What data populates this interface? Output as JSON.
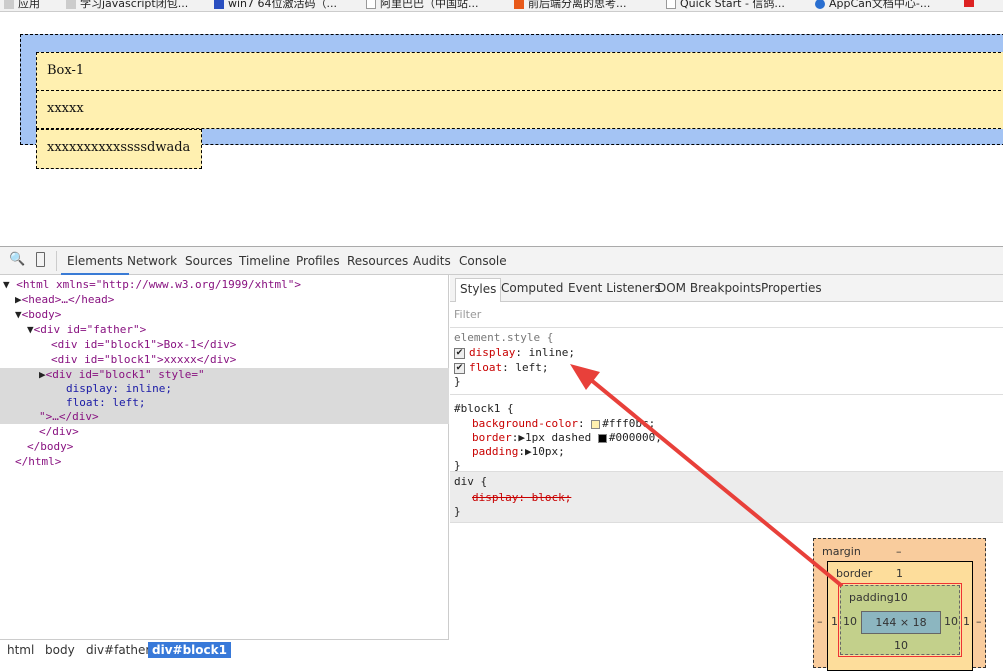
{
  "bookmarks": [
    "应用",
    "学习javascript闭包...",
    "win7 64位激活码（...",
    "阿里巴巴（中国站...",
    "前后端分离的思考...",
    "Quick Start - 信鸽...",
    "AppCan文档中心-..."
  ],
  "page": {
    "box1": "Box-1",
    "box2": "xxxxx",
    "box3": "xxxxxxxxxxssssdwada",
    "colors": {
      "father": "#a4c4f4",
      "block": "#fff0b0"
    }
  },
  "devtools": {
    "tabs": [
      "Elements",
      "Network",
      "Sources",
      "Timeline",
      "Profiles",
      "Resources",
      "Audits",
      "Console"
    ],
    "active_tab": "Elements",
    "dom": {
      "l0": "<html xmlns=\"http://www.w3.org/1999/xhtml\">",
      "l1": "<head>…</head>",
      "l2": "<body>",
      "l3": "<div id=\"father\">",
      "l4": "<div id=\"block1\">Box-1</div>",
      "l5": "<div id=\"block1\">xxxxx</div>",
      "l6": "<div id=\"block1\" style=\"",
      "l7": "display: inline;",
      "l8": "float: left;",
      "l9": "\">…</div>",
      "l10": "</div>",
      "l11": "</body>",
      "l12": "</html>"
    },
    "breadcrumbs": [
      "html",
      "body",
      "div#father",
      "div#block1"
    ],
    "style_tabs": [
      "Styles",
      "Computed",
      "Event Listeners",
      "DOM Breakpoints",
      "Properties"
    ],
    "filter_placeholder": "Filter",
    "rules": {
      "element_style": {
        "selector": "element.style {",
        "p1": "display",
        "v1": ": inline;",
        "p2": "float",
        "v2": ": left;",
        "close": "}"
      },
      "block1": {
        "selector": "#block1 {",
        "p1": "background-color",
        "v1": "#fff0bc;",
        "p2": "border",
        "v2": "1px dashed",
        "v2b": "#000000;",
        "p3": "padding",
        "v3": "10px;",
        "close": "}",
        "swatch1": "#fff0b0",
        "swatch2": "#000000"
      },
      "div": {
        "selector": "div {",
        "p1": "display: block;",
        "close": "}"
      }
    },
    "box_model": {
      "margin_label": "margin",
      "margin_top": "–",
      "border_label": "border",
      "border_top": "1",
      "padding_label": "padding10",
      "content": "144 × 18",
      "padding_left": "10",
      "padding_right": "10",
      "padding_bottom": "10",
      "border_left": "1",
      "border_right": "1",
      "margin_left": "–",
      "margin_right": "–"
    }
  }
}
